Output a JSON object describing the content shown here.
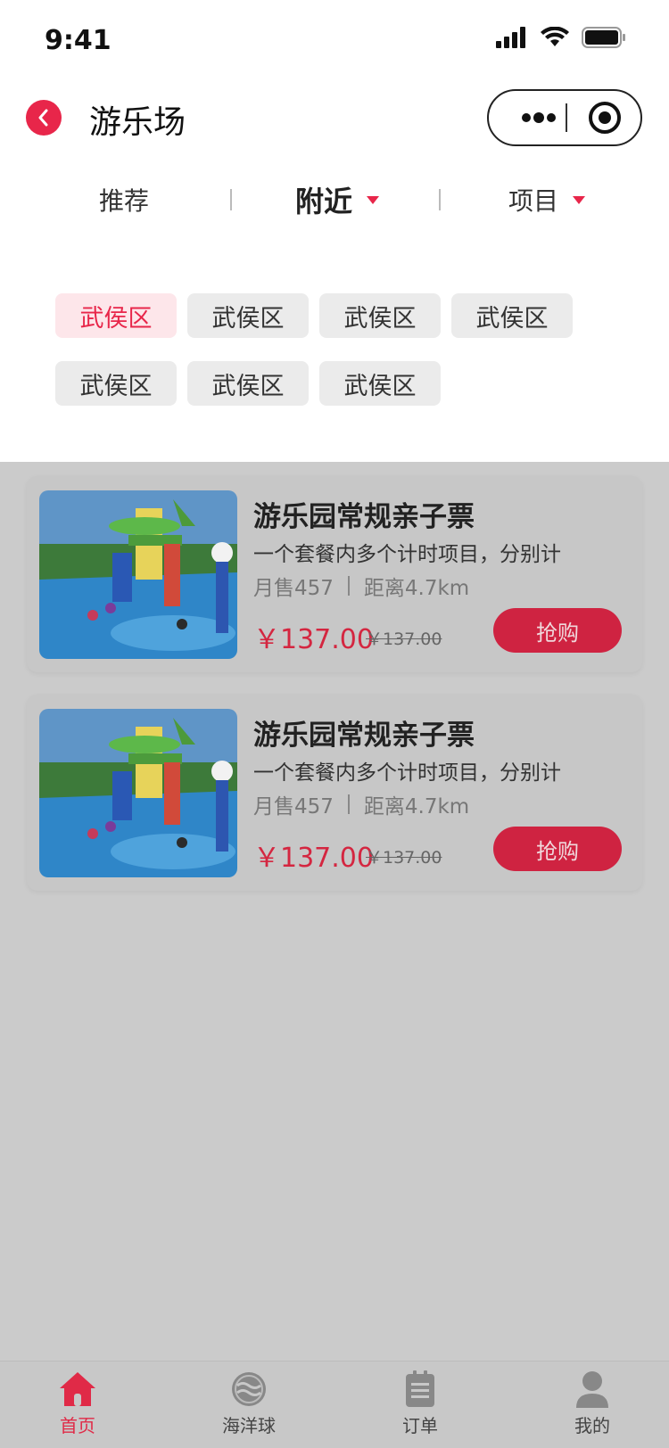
{
  "status_bar": {
    "time": "9:41"
  },
  "nav": {
    "title": "游乐场"
  },
  "tabs": [
    {
      "label": "推荐"
    },
    {
      "label": "附近"
    },
    {
      "label": "项目"
    }
  ],
  "districts": [
    "武侯区",
    "武侯区",
    "武侯区",
    "武侯区",
    "武侯区",
    "武侯区",
    "武侯区"
  ],
  "products": [
    {
      "name": "游乐园常规亲子票",
      "desc": "一个套餐内多个计时项目，分别计",
      "sales": "月售457",
      "distance": "距离4.7km",
      "price": "￥137.00",
      "original_price": "￥137.00",
      "buy_label": "抢购"
    },
    {
      "name": "游乐园常规亲子票",
      "desc": "一个套餐内多个计时项目，分别计",
      "sales": "月售457",
      "distance": "距离4.7km",
      "price": "￥137.00",
      "original_price": "￥137.00",
      "buy_label": "抢购"
    }
  ],
  "tabbar": [
    {
      "label": "首页",
      "icon": "home-icon"
    },
    {
      "label": "海洋球",
      "icon": "ocean-ball-icon"
    },
    {
      "label": "订单",
      "icon": "order-icon"
    },
    {
      "label": "我的",
      "icon": "user-icon"
    }
  ],
  "colors": {
    "accent": "#e8264a",
    "overlay": "#cbcbcb"
  }
}
